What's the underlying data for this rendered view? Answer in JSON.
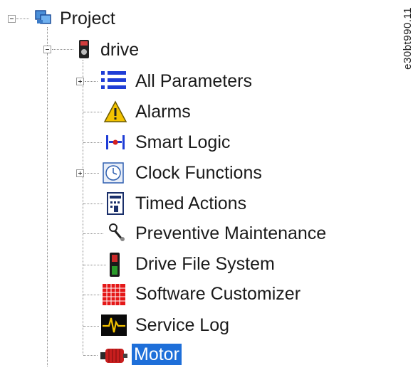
{
  "side_id": "e30bt990.11",
  "tree": {
    "root": {
      "label": "Project",
      "icon": "project-icon"
    },
    "drive": {
      "label": "drive",
      "icon": "drive-icon"
    },
    "items": [
      {
        "label": "All Parameters",
        "icon": "list-icon",
        "expandable": true
      },
      {
        "label": "Alarms",
        "icon": "warning-icon",
        "expandable": false
      },
      {
        "label": "Smart Logic",
        "icon": "smart-logic-icon",
        "expandable": false
      },
      {
        "label": "Clock Functions",
        "icon": "clock-icon",
        "expandable": true
      },
      {
        "label": "Timed Actions",
        "icon": "calendar-icon",
        "expandable": false
      },
      {
        "label": "Preventive Maintenance",
        "icon": "wrench-icon",
        "expandable": false
      },
      {
        "label": "Drive File System",
        "icon": "file-system-icon",
        "expandable": false
      },
      {
        "label": "Software Customizer",
        "icon": "grid-icon",
        "expandable": false
      },
      {
        "label": "Service Log",
        "icon": "oscilloscope-icon",
        "expandable": false
      },
      {
        "label": "Motor",
        "icon": "motor-icon",
        "expandable": false,
        "selected": true
      }
    ]
  },
  "colors": {
    "selection": "#1e6fd9",
    "tree_lines": "#8a8a8a",
    "text": "#1a1a1a"
  }
}
